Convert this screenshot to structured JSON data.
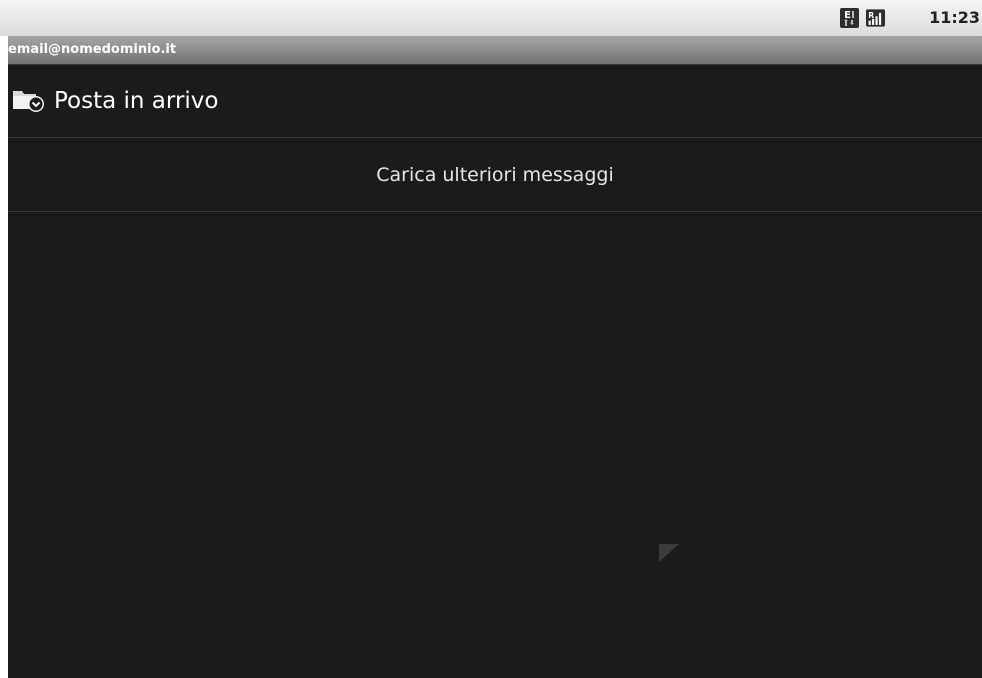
{
  "status_bar": {
    "time": "11:23",
    "network_icon": "edge-network-icon",
    "signal_icon": "signal-strength-icon"
  },
  "account": {
    "email": "email@nomedominio.it"
  },
  "folder": {
    "icon": "inbox-folder-icon",
    "title": "Posta in arrivo"
  },
  "list": {
    "load_more_label": "Carica ulteriori messaggi"
  },
  "colors": {
    "background": "#1b1b1b",
    "status_bar": "#e6e6e6",
    "account_bar": "#8a8a8a",
    "text": "#ffffff"
  }
}
